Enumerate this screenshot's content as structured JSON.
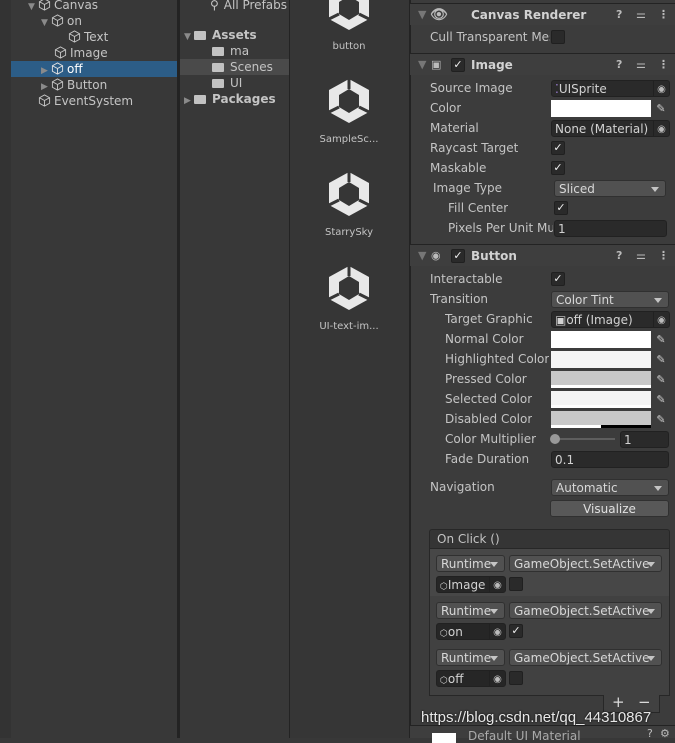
{
  "hierarchy": {
    "items": [
      {
        "label": "Canvas",
        "expanded": true
      },
      {
        "label": "on",
        "expanded": true
      },
      {
        "label": "Text"
      },
      {
        "label": "Image"
      },
      {
        "label": "off",
        "selected": true,
        "collapsed": true
      },
      {
        "label": "Button",
        "collapsed": true
      },
      {
        "label": "EventSystem"
      }
    ]
  },
  "project": {
    "all_prefabs": "All Prefabs",
    "assets": "Assets",
    "folders": [
      "ma",
      "Scenes",
      "UI"
    ],
    "packages": "Packages",
    "files": [
      "button",
      "SampleSc...",
      "StarrySky",
      "UI-text-im..."
    ]
  },
  "inspector": {
    "canvas_renderer": {
      "title": "Canvas Renderer",
      "cull_label": "Cull Transparent Mes",
      "cull_checked": false
    },
    "image": {
      "title": "Image",
      "enabled": true,
      "source_image_label": "Source Image",
      "source_image_value": "UISprite",
      "color_label": "Color",
      "color": "#ffffff",
      "material_label": "Material",
      "material_value": "None (Material)",
      "raycast_label": "Raycast Target",
      "raycast_checked": true,
      "maskable_label": "Maskable",
      "maskable_checked": true,
      "image_type_label": "Image Type",
      "image_type_value": "Sliced",
      "fill_center_label": "Fill Center",
      "fill_center_checked": true,
      "ppu_label": "Pixels Per Unit Mul",
      "ppu_value": "1"
    },
    "button": {
      "title": "Button",
      "enabled": true,
      "interactable_label": "Interactable",
      "interactable_checked": true,
      "transition_label": "Transition",
      "transition_value": "Color Tint",
      "target_graphic_label": "Target Graphic",
      "target_graphic_value": "off (Image)",
      "colors": [
        {
          "label": "Normal Color",
          "color": "#ffffff"
        },
        {
          "label": "Highlighted Color",
          "color": "#f5f5f5"
        },
        {
          "label": "Pressed Color",
          "color": "#c8c8c8"
        },
        {
          "label": "Selected Color",
          "color": "#f5f5f5"
        },
        {
          "label": "Disabled Color",
          "color": "#c8c8c8"
        }
      ],
      "multiplier_label": "Color Multiplier",
      "multiplier_value": "1",
      "fade_label": "Fade Duration",
      "fade_value": "0.1",
      "navigation_label": "Navigation",
      "navigation_value": "Automatic",
      "visualize_label": "Visualize"
    },
    "on_click": {
      "title": "On Click ()",
      "entries": [
        {
          "mode": "Runtime",
          "function": "GameObject.SetActive",
          "target": "Image",
          "checked": false
        },
        {
          "mode": "Runtime",
          "function": "GameObject.SetActive",
          "target": "on",
          "checked": true
        },
        {
          "mode": "Runtime",
          "function": "GameObject.SetActive",
          "target": "off",
          "checked": false
        }
      ],
      "add_label": "+",
      "remove_label": "−"
    },
    "material_footer": "Default UI Material"
  },
  "watermark": "https://blog.csdn.net/qq_44310867"
}
